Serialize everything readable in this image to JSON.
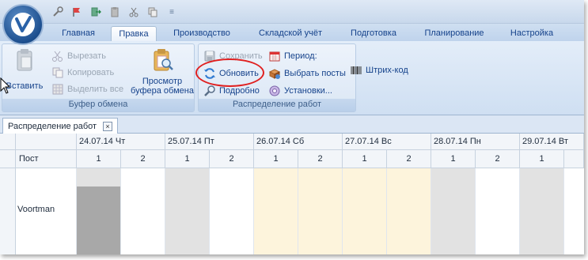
{
  "qat": {
    "icons": [
      "wrench-icon",
      "flag-icon",
      "exit-icon",
      "clipboard-icon",
      "cut-icon",
      "copy-icon",
      "dropdown-icon"
    ]
  },
  "tabs": [
    {
      "label": "Главная",
      "active": false
    },
    {
      "label": "Правка",
      "active": true
    },
    {
      "label": "Производство",
      "active": false
    },
    {
      "label": "Складской учёт",
      "active": false
    },
    {
      "label": "Подготовка",
      "active": false
    },
    {
      "label": "Планирование",
      "active": false
    },
    {
      "label": "Настройка",
      "active": false
    }
  ],
  "clipboard_group": {
    "label": "Буфер обмена",
    "paste": "Вставить",
    "cut": "Вырезать",
    "copy": "Копировать",
    "select_all": "Выделить все",
    "view_clipboard": "Просмотр буфера обмена"
  },
  "distribution_group": {
    "label": "Распределение работ",
    "save": "Сохранить",
    "refresh": "Обновить",
    "details": "Подробно",
    "period": "Период:",
    "select_posts": "Выбрать посты",
    "barcode": "Штрих-код",
    "settings": "Установки..."
  },
  "document_tab": {
    "title": "Распределение работ",
    "close": "×"
  },
  "grid": {
    "post_header": "Пост",
    "dates": [
      "24.07.14 Чт",
      "25.07.14 Пт",
      "26.07.14 Сб",
      "27.07.14 Вс",
      "28.07.14 Пн",
      "29.07.14 Вт"
    ],
    "shifts": [
      "1",
      "2"
    ],
    "rows": [
      {
        "post": "Voortman"
      }
    ]
  },
  "colors": {
    "weekend_fill": "#fdf4dc",
    "weekday_fill": "#e2e2e2",
    "occupied_fill": "#a8a8a8",
    "highlight_ring": "#e02020"
  }
}
